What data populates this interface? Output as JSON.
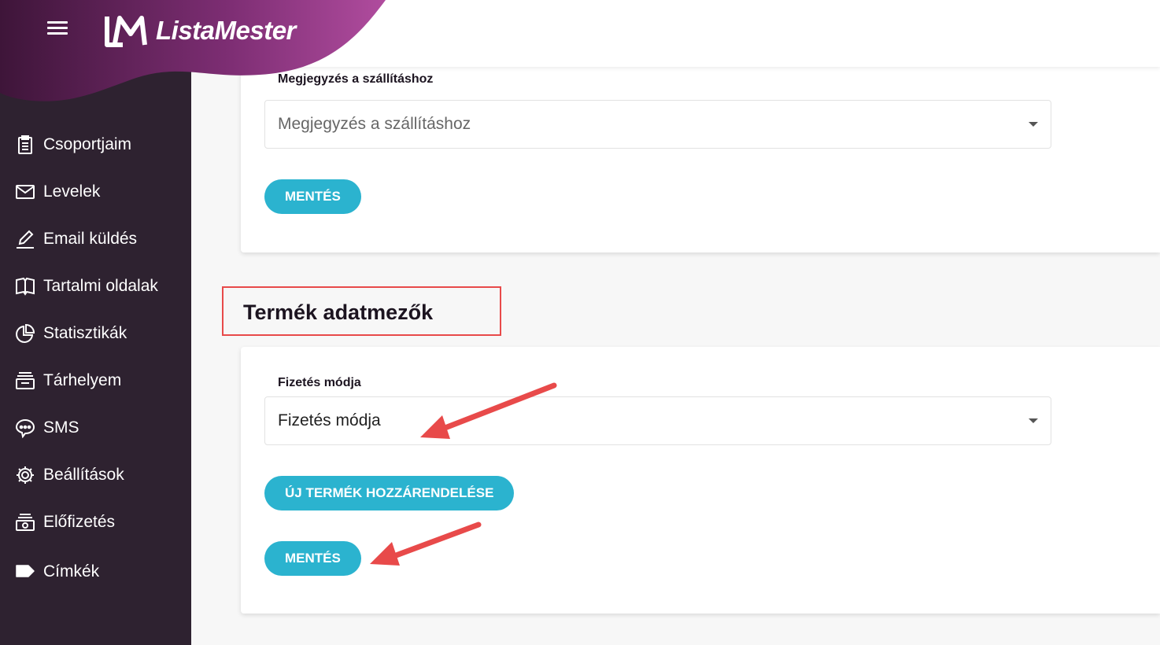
{
  "brand": {
    "name": "ListaMester"
  },
  "sidebar": {
    "items": [
      {
        "label": "Csoportjaim",
        "icon": "clipboard-icon"
      },
      {
        "label": "Levelek",
        "icon": "envelope-icon"
      },
      {
        "label": "Email küldés",
        "icon": "pencil-icon"
      },
      {
        "label": "Tartalmi oldalak",
        "icon": "book-icon"
      },
      {
        "label": "Statisztikák",
        "icon": "pie-chart-icon"
      },
      {
        "label": "Tárhelyem",
        "icon": "storage-icon"
      },
      {
        "label": "SMS",
        "icon": "chat-icon"
      },
      {
        "label": "Beállítások",
        "icon": "gear-icon"
      },
      {
        "label": "Előfizetés",
        "icon": "subscription-icon"
      },
      {
        "label": "Címkék",
        "icon": "tag-icon"
      }
    ]
  },
  "shipping_card": {
    "label": "Megjegyzés a szállításhoz",
    "select_value": "Megjegyzés a szállításhoz",
    "save_label": "MENTÉS"
  },
  "product_section": {
    "title": "Termék adatmezők",
    "label": "Fizetés módja",
    "select_value": "Fizetés módja",
    "assign_label": "ÚJ TERMÉK HOZZÁRENDELÉSE",
    "save_label": "MENTÉS"
  },
  "colors": {
    "sidebar_bg": "#2e2230",
    "brand_gradient_start": "#4a1745",
    "brand_gradient_end": "#a9479a",
    "button_bg": "#2bb3cf",
    "annotation_red": "#e84a4a"
  }
}
